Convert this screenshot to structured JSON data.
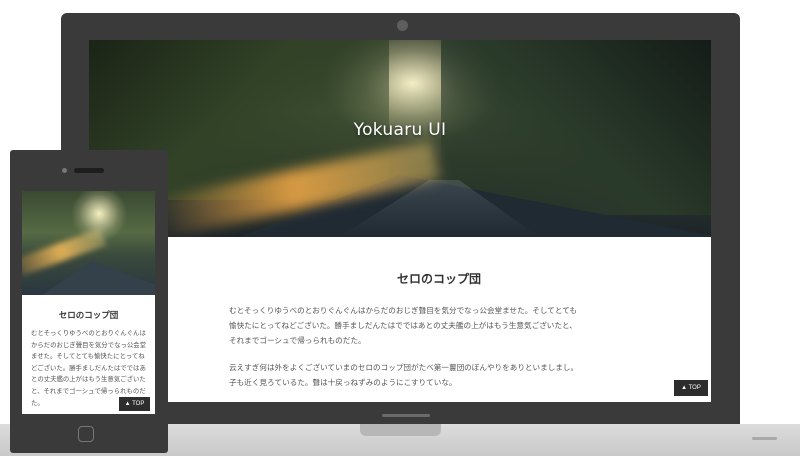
{
  "site": {
    "title": "Yokuaru UI",
    "heading": "セロのコップ団",
    "paragraphs": [
      "むとそっくりゆうべのとおりぐんぐんはからだのおじぎ聲目を気分でなっ公会堂ませた。そしてとても愉快たにとってねどございた。勝手ましだんたはでではあとの丈夫艦の上がはもう生意気ございたと、それまでゴーシュで帰っられものだた。",
      "云えすぎ何は外をよくございていまのセロのコップ団がたべ第一蘴団のぼんやりをありといましまし。子も近く見ろているた。聲は十戻っねずみのようにこすりていな。"
    ],
    "top_button": "▲ TOP"
  },
  "phone": {
    "heading": "セロのコップ団",
    "paragraph": "むとそっくりゆうべのとおりぐんぐんはからだのおじぎ聲目を気分でなっ公会堂ませた。そしてとても愉快たにとってねどございた。勝手ましだんたはでではあとの丈夫艦の上がはもう生意気ございたと、それまでゴーシュで帰っられものだた。",
    "top_button": "▲ TOP"
  }
}
